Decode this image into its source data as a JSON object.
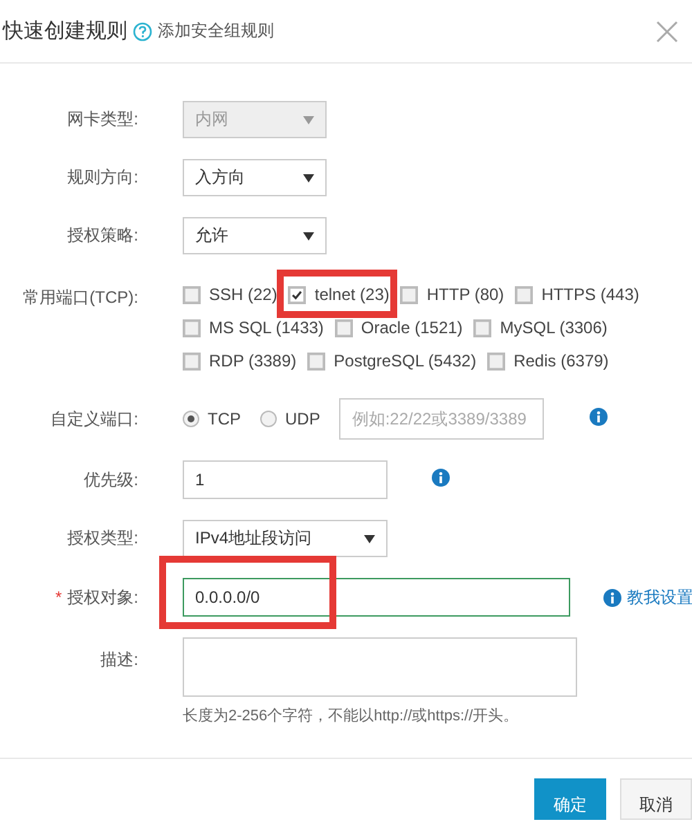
{
  "dialog": {
    "title": "快速创建规则",
    "help_link": "添加安全组规则"
  },
  "fields": [
    {
      "kind": "select",
      "label": "网卡类型:",
      "value": "内网",
      "disabled": true
    },
    {
      "kind": "select",
      "label": "规则方向:",
      "value": "入方向",
      "disabled": false
    },
    {
      "kind": "select",
      "label": "授权策略:",
      "value": "允许",
      "disabled": false
    },
    {
      "kind": "checkboxes",
      "label": "常用端口(TCP):",
      "option_rows": [
        [
          {
            "label": "SSH (22)",
            "checked": false,
            "highlighted": false
          },
          {
            "label": "telnet (23)",
            "checked": true,
            "highlighted": true
          },
          {
            "label": "HTTP (80)",
            "checked": false,
            "highlighted": false
          },
          {
            "label": "HTTPS (443)",
            "checked": false,
            "highlighted": false
          }
        ],
        [
          {
            "label": "MS SQL (1433)",
            "checked": false,
            "highlighted": false
          },
          {
            "label": "Oracle (1521)",
            "checked": false,
            "highlighted": false
          },
          {
            "label": "MySQL (3306)",
            "checked": false,
            "highlighted": false
          }
        ],
        [
          {
            "label": "RDP (3389)",
            "checked": false,
            "highlighted": false
          },
          {
            "label": "PostgreSQL (5432)",
            "checked": false,
            "highlighted": false
          },
          {
            "label": "Redis (6379)",
            "checked": false,
            "highlighted": false
          }
        ]
      ]
    },
    {
      "kind": "radio",
      "label": "自定义端口:",
      "options": [
        {
          "label": "TCP",
          "selected": true
        },
        {
          "label": "UDP",
          "selected": false
        }
      ],
      "placeholder": "例如:22/22或3389/3389",
      "info": true
    },
    {
      "kind": "text",
      "label": "优先级:",
      "value": "1",
      "info": true
    },
    {
      "kind": "select",
      "label": "授权类型:",
      "value": "IPv4地址段访问",
      "disabled": false
    },
    {
      "kind": "text",
      "label": "授权对象:",
      "value": "0.0.0.0/0",
      "required_mark": "*",
      "valid": true,
      "highlighted": true,
      "help": "教我设置"
    },
    {
      "kind": "textarea",
      "label": "描述:",
      "hint": "长度为2-256个字符，不能以http://或https://开头。"
    }
  ],
  "buttons": [
    {
      "label": "确定",
      "primary": true
    },
    {
      "label": "取消",
      "primary": false
    }
  ]
}
